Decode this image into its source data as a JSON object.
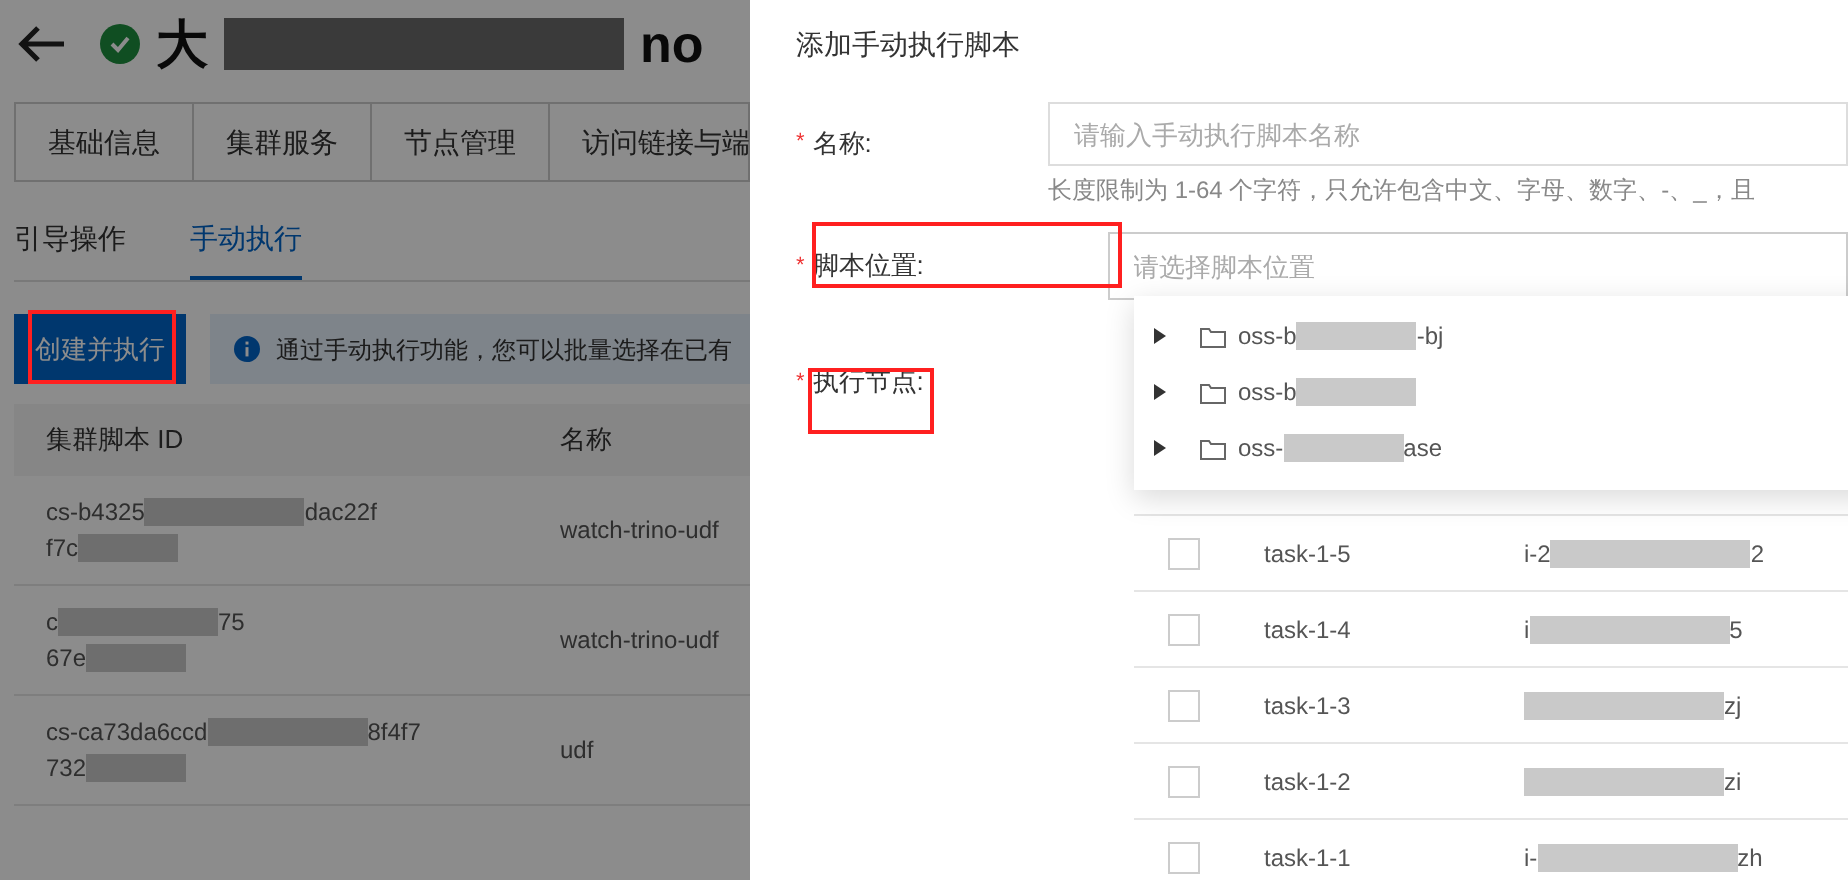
{
  "page": {
    "title_start": "大",
    "title_end": "no"
  },
  "tabs": [
    {
      "label": "基础信息",
      "selected": false
    },
    {
      "label": "集群服务",
      "selected": false
    },
    {
      "label": "节点管理",
      "selected": false
    },
    {
      "label": "访问链接与端",
      "selected": false
    }
  ],
  "subtabs": [
    {
      "label": "引导操作",
      "selected": false
    },
    {
      "label": "手动执行",
      "selected": true
    }
  ],
  "create_button": "创建并执行",
  "notice": "通过手动执行功能，您可以批量选择在已有",
  "table": {
    "columns": [
      "集群脚本 ID",
      "名称"
    ],
    "rows": [
      {
        "id_start": "cs-b4325",
        "id_end": "dac22f",
        "id_line2": "f7c",
        "name": "watch-trino-udf"
      },
      {
        "id_start": "c",
        "id_end": "75",
        "id_line2": "67e",
        "name": "watch-trino-udf"
      },
      {
        "id_start": "cs-ca73da6ccd",
        "id_end": "8f4f7",
        "id_line2": "732",
        "name": "udf"
      }
    ]
  },
  "drawer": {
    "title": "添加手动执行脚本",
    "name_field": {
      "label": "名称:",
      "marker": "*",
      "placeholder": "请输入手动执行脚本名称",
      "hint": "长度限制为 1-64 个字符，只允许包含中文、字母、数字、-、_，且"
    },
    "location_field": {
      "label": "脚本位置:",
      "marker": "*",
      "placeholder": "请选择脚本位置",
      "expanded": true
    },
    "location_options": [
      {
        "start": "oss-b",
        "end": "-bj",
        "expanded": false
      },
      {
        "start": "oss-b",
        "expanded": false
      },
      {
        "start": "oss-",
        "end": "ase",
        "expanded": false
      }
    ],
    "nodes_field": {
      "label": "执行节点:",
      "marker": "*"
    },
    "nodes": [
      {
        "name": "task-1-5",
        "id_start": "i-2",
        "id_end": "2",
        "checked": false
      },
      {
        "name": "task-1-4",
        "id_start": "i",
        "id_end": "5",
        "checked": false
      },
      {
        "name": "task-1-3",
        "id_end": "zj",
        "checked": false
      },
      {
        "name": "task-1-2",
        "id_end": "zi",
        "checked": false
      },
      {
        "name": "task-1-1",
        "id_start": "i-",
        "id_end": "zh",
        "checked": false
      }
    ]
  }
}
